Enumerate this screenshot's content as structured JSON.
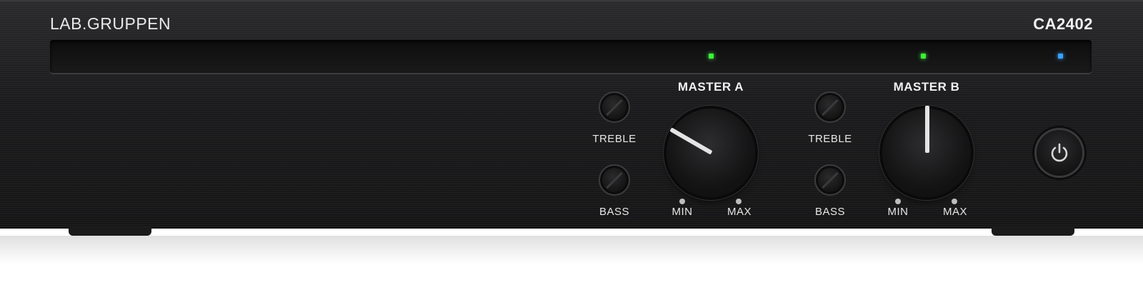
{
  "device": {
    "brand": "LAB.GRUPPEN",
    "model": "CA2402"
  },
  "channel_a": {
    "heading": "MASTER A",
    "treble_label": "TREBLE",
    "bass_label": "BASS",
    "min_label": "MIN",
    "max_label": "MAX",
    "level_color": "#3ef03a"
  },
  "channel_b": {
    "heading": "MASTER B",
    "treble_label": "TREBLE",
    "bass_label": "BASS",
    "min_label": "MIN",
    "max_label": "MAX",
    "level_color": "#3ef03a"
  },
  "indicators": {
    "channel_a_led": "green",
    "channel_b_led": "green",
    "power_led": "blue"
  },
  "power_button": {
    "icon": "power-icon"
  }
}
